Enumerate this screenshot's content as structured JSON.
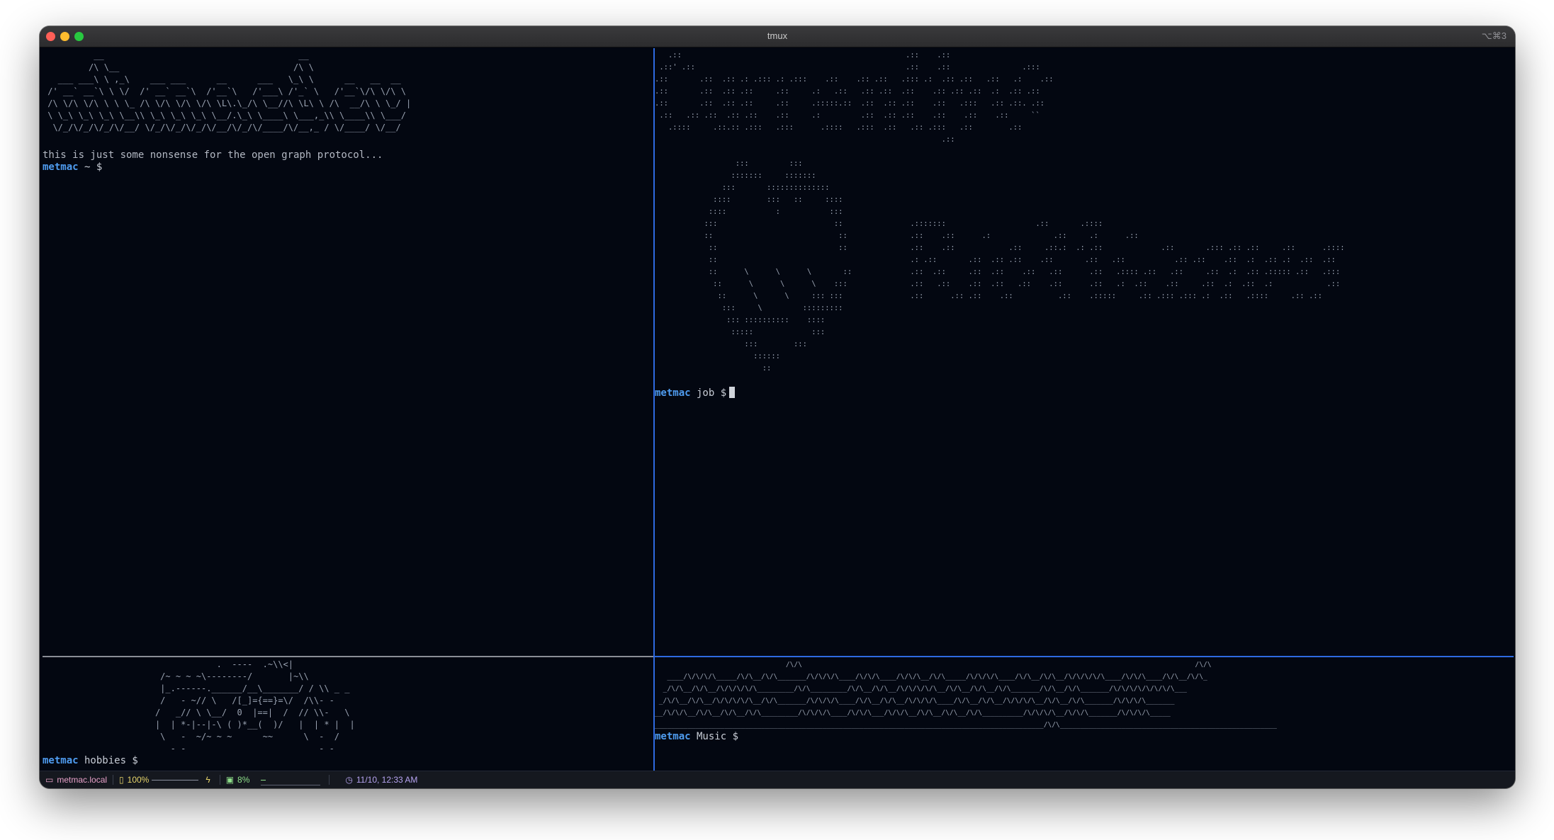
{
  "window": {
    "title": "tmux",
    "shortcut": "⌥⌘3"
  },
  "panes": {
    "top_left": {
      "art": "          __                                      __\n         /\\ \\__                                  /\\ \\\n   ___ ___\\ \\ ,_\\    ___ ___      __      ___   \\_\\ \\      __   __  __\n /' __` __`\\ \\ \\/  /' __` __`\\  /'__`\\   /'___\\ /'_` \\   /'__`\\/\\ \\/\\ \\\n /\\ \\/\\ \\/\\ \\ \\ \\_ /\\ \\/\\ \\/\\ \\/\\ \\L\\.\\_/\\ \\__//\\ \\L\\ \\ /\\  __/\\ \\ \\_/ |\n \\ \\_\\ \\_\\ \\_\\ \\__\\\\ \\_\\ \\_\\ \\_\\ \\__/.\\_\\ \\____\\ \\___,_\\\\ \\____\\\\ \\___/\n  \\/_/\\/_/\\/_/\\/__/ \\/_/\\/_/\\/_/\\/__/\\/_/\\/____/\\/__,_ / \\/____/ \\/__/",
      "message": "this is just some nonsense for the open graph protocol...",
      "prompt_user": "metmac",
      "prompt_rest": " ~ $"
    },
    "top_right": {
      "art": "   .::                                                  .::    .::\n .::' .::                                               .::    .::                .:::\n.::       .::  .:: .: .::: .: .:::    .::    .:: .::   .::: .:  .:: .::   .::   .:    .::\n.::       .::  .:: .::     .::     .:   .::   .:: .::  .::    .:: .:: .::  .:  .:: .::\n.::       .::  .:: .::     .::     .:::::.::  .::  .:: .::    .::   .:::   .:: .::. .::\n .::   .:: .::  .:: .::    .::     .:         .::  .:: .::    .::    .::    .::     ``\n   .::::     .::.:: .:::   .:::      .::::   .:::  .::   .:: .:::   .::        .::\n                                                                .::\n\n                  :::         :::\n                 :::::::     :::::::\n               :::       ::::::::::::::\n             ::::        :::   ::     ::::\n            ::::           :           :::\n           :::                          ::               .:::::::                    .::       .::::\n           ::                            ::              .::    .::      .:              .::     .:      .::\n            ::                           ::              .::    .::            .::     .::.:  .: .::             .::       .::: .:: .::     .::      .::::\n            ::                                           .: .::       .::  .:: .::    .::       .::   .::           .:: .::    .::  .:  .:: .:  .::  .::\n            ::      \\      \\      \\       ::             .::  .::     .::  .::    .::   .::      .::   .:::: .::   .::     .::  .:  .:: .::::: .::   .:::\n             ::      \\      \\      \\    :::              .::   .::    .::  .::   .::    .::      .::   .:  .::    .::     .::  .:  .::  .:            .::\n              ::      \\      \\     ::: :::               .::      .:: .::    .::          .::    .:::::     .:: .::: .::: .:  .::   .::::     .:: .::\n               :::     \\         :::::::::\n                ::: ::::::::::    ::::\n                 :::::             :::\n                    :::        :::\n                      ::::::\n                        ::",
      "prompt_user": "metmac",
      "prompt_rest": " job $"
    },
    "bottom_left": {
      "art": "                                  .  ----  .~\\\\<|\n                       /~ ~ ~ ~\\--------/       |~\\\\\n                       |_.------.______/__\\_______/ / \\\\ _ _\n                       /   - ~// \\   /[_]={==}=\\/  /\\\\- -\n                      /   _// \\ \\__/  0  |==|  /  // \\\\-   \\\n                      |  | *-|--|-\\ ( )*__(  )/   |  | * |  |\n                       \\   -  ~/~ ~ ~      ~~      \\  -  /\n                         - -                          - -",
      "prompt_user": "metmac",
      "prompt_rest": " hobbies $"
    },
    "bottom_right": {
      "art": "                                /\\/\\                                                                                                /\\/\\\n   ____/\\/\\/\\/\\_____/\\/\\__/\\/\\_______/\\/\\/\\/\\____/\\/\\/\\____/\\/\\/\\__/\\/\\_____/\\/\\/\\/\\____/\\/\\__/\\/\\__/\\/\\/\\/\\/\\____/\\/\\/\\____/\\/\\__/\\/\\_\n  _/\\/\\__/\\/\\__/\\/\\/\\/\\/\\_________/\\/\\_________/\\/\\__/\\/\\__/\\/\\/\\/\\/\\__/\\/\\__/\\/\\__/\\/\\_______/\\/\\__/\\/\\_______/\\/\\/\\/\\/\\/\\/\\/\\___\n _/\\/\\__/\\/\\__/\\/\\/\\/\\/\\__/\\/\\_______/\\/\\/\\/\\____/\\/\\__/\\/\\__/\\/\\/\\/\\____/\\/\\__/\\/\\__/\\/\\/\\/\\__/\\/\\__/\\/\\_______/\\/\\/\\/\\_______\n__/\\/\\/\\__/\\/\\__/\\/\\__/\\/\\_________/\\/\\/\\/\\____/\\/\\/\\___/\\/\\/\\__/\\/\\__/\\/\\__/\\/\\__________/\\/\\/\\/\\__/\\/\\/\\_______/\\/\\/\\/\\_____\n_______________________________________________________________________________________________/\\/\\_____________________________________________________",
      "prompt_user": "metmac",
      "prompt_rest": " Music $"
    }
  },
  "statusbar": {
    "host": "metmac.local",
    "battery": "100%",
    "cpu": "8%",
    "datetime": "11/10, 12:33 AM",
    "battery_level": 1.0,
    "cpu_level": 0.08,
    "colors": {
      "host": "#e7a0c8",
      "battery": "#e6d46a",
      "cpu": "#8fe08a",
      "time": "#b6a3f0"
    },
    "icons": {
      "host": "laptop-icon",
      "battery": "battery-icon",
      "charging": "lightning-icon",
      "cpu": "cpu-icon",
      "time": "clock-icon"
    }
  }
}
